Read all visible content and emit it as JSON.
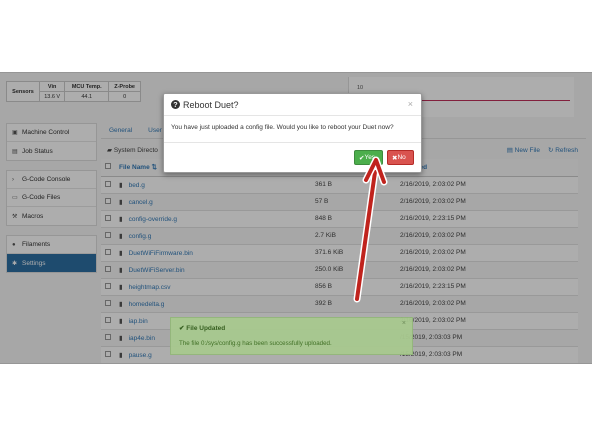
{
  "sensors": {
    "row_label": "Sensors",
    "headers": [
      "Vin",
      "MCU Temp.",
      "Z-Probe"
    ],
    "values": [
      "13.6 V",
      "44.1",
      "0"
    ]
  },
  "chart": {
    "label": "10",
    "line_color": "#c0305a"
  },
  "sidebar": {
    "group1": [
      {
        "label": "Machine Control",
        "icon": "machine-icon"
      },
      {
        "label": "Job Status",
        "icon": "file-icon"
      }
    ],
    "group2": [
      {
        "label": "G-Code Console",
        "icon": "console-icon"
      },
      {
        "label": "G-Code Files",
        "icon": "folder-icon"
      },
      {
        "label": "Macros",
        "icon": "wrench-icon"
      }
    ],
    "group3": [
      {
        "label": "Filaments",
        "icon": "circle-icon"
      },
      {
        "label": "Settings",
        "icon": "gear-icon",
        "active": true
      }
    ]
  },
  "tabs": [
    "General",
    "User"
  ],
  "sysdir": {
    "label": "System Directo",
    "new_file": "New File",
    "refresh": "Refresh"
  },
  "files": {
    "headers": {
      "name": "File Name",
      "size": "",
      "modified": "modified"
    },
    "rows": [
      {
        "name": "bed.g",
        "size": "361 B",
        "date": "2/16/2019, 2:03:02 PM"
      },
      {
        "name": "cancel.g",
        "size": "57 B",
        "date": "2/16/2019, 2:03:02 PM"
      },
      {
        "name": "config-override.g",
        "size": "848 B",
        "date": "2/16/2019, 2:23:15 PM"
      },
      {
        "name": "config.g",
        "size": "2.7 KiB",
        "date": "2/16/2019, 2:03:02 PM"
      },
      {
        "name": "DuetWiFiFirmware.bin",
        "size": "371.6 KiB",
        "date": "2/16/2019, 2:03:02 PM"
      },
      {
        "name": "DuetWiFiServer.bin",
        "size": "250.0 KiB",
        "date": "2/16/2019, 2:03:02 PM"
      },
      {
        "name": "heightmap.csv",
        "size": "856 B",
        "date": "2/16/2019, 2:23:15 PM"
      },
      {
        "name": "homedelta.g",
        "size": "392 B",
        "date": "2/16/2019, 2:03:02 PM"
      },
      {
        "name": "iap.bin",
        "size": "",
        "date": "2/16/2019, 2:03:02 PM"
      },
      {
        "name": "iap4e.bin",
        "size": "",
        "date": "/15/2019, 2:03:03 PM"
      },
      {
        "name": "pause.g",
        "size": "",
        "date": "/15/2019, 2:03:03 PM"
      }
    ]
  },
  "modal": {
    "title": "Reboot Duet?",
    "body": "You have just uploaded a config file. Would you like to reboot your Duet now?",
    "yes_label": "Yes",
    "no_label": "No"
  },
  "toast": {
    "title": "File Updated",
    "message": "The file 0:/sys/config.g has been successfully uploaded."
  },
  "colors": {
    "accent": "#2d6fa3",
    "yes": "#4cae4c",
    "no": "#d9534f",
    "arrow": "#c0231d"
  }
}
